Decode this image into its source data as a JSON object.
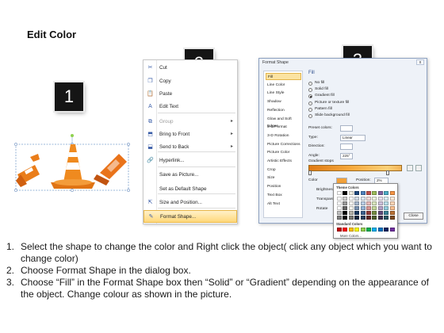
{
  "title": "Edit Color",
  "badges": [
    "1",
    "2",
    "3"
  ],
  "context_menu": {
    "items": [
      {
        "label": "Cut",
        "icon": "scissors-icon",
        "glyph": "✂",
        "disabled": false,
        "submenu": false
      },
      {
        "label": "Copy",
        "icon": "copy-icon",
        "glyph": "❐",
        "disabled": false,
        "submenu": false
      },
      {
        "label": "Paste",
        "icon": "paste-icon",
        "glyph": "📋",
        "disabled": false,
        "submenu": false
      },
      {
        "label": "Edit Text",
        "icon": "edit-text-icon",
        "glyph": "A",
        "disabled": false,
        "submenu": false
      },
      {
        "label": "Group",
        "icon": "group-icon",
        "glyph": "⧉",
        "disabled": true,
        "submenu": true
      },
      {
        "label": "Bring to Front",
        "icon": "bring-to-front-icon",
        "glyph": "⬒",
        "disabled": false,
        "submenu": true
      },
      {
        "label": "Send to Back",
        "icon": "send-to-back-icon",
        "glyph": "⬓",
        "disabled": false,
        "submenu": true
      },
      {
        "label": "Hyperlink...",
        "icon": "hyperlink-icon",
        "glyph": "🔗",
        "disabled": false,
        "submenu": false
      },
      {
        "label": "Save as Picture...",
        "icon": "",
        "glyph": "",
        "disabled": false,
        "submenu": false
      },
      {
        "label": "Set as Default Shape",
        "icon": "",
        "glyph": "",
        "disabled": false,
        "submenu": false
      },
      {
        "label": "Size and Position...",
        "icon": "size-position-icon",
        "glyph": "⇱",
        "disabled": false,
        "submenu": false
      },
      {
        "label": "Format Shape...",
        "icon": "format-shape-icon",
        "glyph": "✎",
        "disabled": false,
        "submenu": false,
        "highlighted": true
      }
    ]
  },
  "dialog": {
    "title": "Format Shape",
    "close_x": "x",
    "categories": [
      "Fill",
      "Line Color",
      "Line Style",
      "Shadow",
      "Reflection",
      "Glow and Soft Edges",
      "3-D Format",
      "3-D Rotation",
      "Picture Corrections",
      "Picture Color",
      "Artistic Effects",
      "Crop",
      "Size",
      "Position",
      "Text Box",
      "Alt Text"
    ],
    "selected_category": "Fill",
    "heading": "Fill",
    "fill_options": [
      "No fill",
      "Solid fill",
      "Gradient fill",
      "Picture or texture fill",
      "Pattern fill",
      "Slide background fill"
    ],
    "selected_fill": "Gradient fill",
    "preset_colors_label": "Preset colors:",
    "type_label": "Type:",
    "type_value": "Linear",
    "direction_label": "Direction:",
    "angle_label": "Angle:",
    "angle_value": "225°",
    "gradient_stops_label": "Gradient stops",
    "color_label": "Color",
    "position_label": "Position:",
    "position_value": "2%",
    "brightness_label": "Brightness:",
    "transparency_label": "Transparenc",
    "rotate_label": "Rotate",
    "close_button": "Close"
  },
  "palette": {
    "theme_label": "Theme Colors",
    "standard_label": "Standard Colors",
    "more_label": "More Colors...",
    "theme_top": [
      "#ffffff",
      "#000000",
      "#eeece1",
      "#1f497d",
      "#4f81bd",
      "#c0504d",
      "#9bbb59",
      "#8064a2",
      "#4bacc6",
      "#f79646"
    ],
    "standard": [
      "#c00000",
      "#ff0000",
      "#ffc000",
      "#ffff00",
      "#92d050",
      "#00b050",
      "#00b0f0",
      "#0070c0",
      "#002060",
      "#7030a0"
    ]
  },
  "instructions": [
    {
      "num": "1.",
      "text": "Select the shape to change the color and Right click the object( click any object which you want to change color)"
    },
    {
      "num": "2.",
      "text": "Choose Format Shape in the dialog box."
    },
    {
      "num": "3.",
      "text": "Choose “Fill” in the Format Shape box then “Solid” or “Gradient” depending on the appearance of the object. Change colour as shown in the picture."
    }
  ]
}
